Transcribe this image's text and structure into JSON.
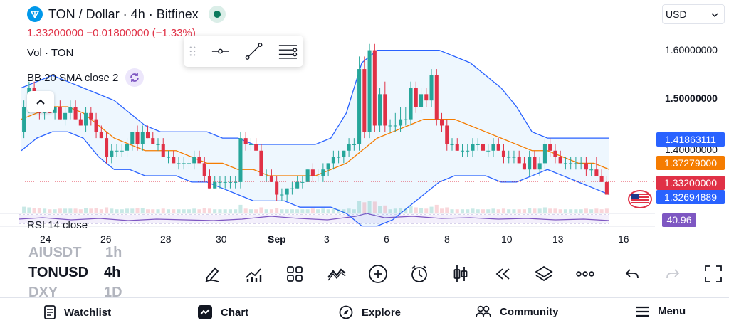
{
  "header": {
    "symbol_title": "TON / Dollar · 4h · Bitfinex",
    "price_line": "1.33200000  −0.01800000 (−1.33%)",
    "volume_label": "Vol · TON",
    "bb_label": "BB 20 SMA close 2"
  },
  "currency_selector": {
    "value": "USD"
  },
  "price_axis": {
    "ticks": [
      "1.60000000",
      "1.50000000",
      "1.40000000"
    ]
  },
  "price_labels": {
    "upper_band": "1.41863111",
    "basis": "1.37279000",
    "last_price": "1.33200000",
    "lower_band": "1.32694889"
  },
  "rsi": {
    "label": "RSI 14 close",
    "value": "40.96"
  },
  "time_axis": [
    "24",
    "26",
    "28",
    "30",
    "Sep",
    "3",
    "6",
    "8",
    "10",
    "13",
    "16"
  ],
  "watchlist": {
    "prev": "AIUSDT",
    "prev_tf": "1h",
    "current": "TONUSD",
    "current_tf": "4h",
    "next": "DXY",
    "next_tf": "1D"
  },
  "bottom_nav": [
    {
      "label": "Watchlist",
      "icon": "watchlist-icon"
    },
    {
      "label": "Chart",
      "icon": "chart-icon"
    },
    {
      "label": "Explore",
      "icon": "compass-icon"
    },
    {
      "label": "Community",
      "icon": "community-icon"
    },
    {
      "label": "Menu",
      "icon": "menu-icon"
    }
  ],
  "colors": {
    "up": "#26a69a",
    "down": "#e03146",
    "band": "#2962ff",
    "basis": "#f57c00",
    "rsi": "#7e57c2",
    "ton": "#0098ea"
  },
  "chart_data": {
    "type": "candlestick",
    "price_range": [
      1.3,
      1.64
    ],
    "x_labels": [
      "24",
      "26",
      "28",
      "30",
      "Sep",
      "3",
      "6",
      "8",
      "10",
      "13",
      "16"
    ],
    "candles": [
      [
        1.43,
        1.48,
        1.42,
        1.47
      ],
      [
        1.47,
        1.51,
        1.46,
        1.5
      ],
      [
        1.5,
        1.51,
        1.47,
        1.48
      ],
      [
        1.48,
        1.49,
        1.45,
        1.46
      ],
      [
        1.46,
        1.48,
        1.45,
        1.47
      ],
      [
        1.47,
        1.48,
        1.46,
        1.46
      ],
      [
        1.46,
        1.47,
        1.45,
        1.47
      ],
      [
        1.47,
        1.48,
        1.45,
        1.45
      ],
      [
        1.45,
        1.47,
        1.44,
        1.46
      ],
      [
        1.46,
        1.48,
        1.45,
        1.47
      ],
      [
        1.47,
        1.48,
        1.45,
        1.45
      ],
      [
        1.45,
        1.46,
        1.44,
        1.44
      ],
      [
        1.44,
        1.47,
        1.43,
        1.46
      ],
      [
        1.46,
        1.47,
        1.44,
        1.45
      ],
      [
        1.45,
        1.46,
        1.42,
        1.43
      ],
      [
        1.43,
        1.44,
        1.42,
        1.42
      ],
      [
        1.42,
        1.43,
        1.38,
        1.39
      ],
      [
        1.39,
        1.41,
        1.38,
        1.4
      ],
      [
        1.4,
        1.41,
        1.39,
        1.4
      ],
      [
        1.4,
        1.41,
        1.39,
        1.4
      ],
      [
        1.4,
        1.42,
        1.39,
        1.41
      ],
      [
        1.41,
        1.43,
        1.4,
        1.43
      ],
      [
        1.43,
        1.44,
        1.4,
        1.41
      ],
      [
        1.41,
        1.44,
        1.4,
        1.43
      ],
      [
        1.43,
        1.44,
        1.42,
        1.42
      ],
      [
        1.42,
        1.43,
        1.41,
        1.41
      ],
      [
        1.41,
        1.42,
        1.4,
        1.41
      ],
      [
        1.41,
        1.42,
        1.39,
        1.39
      ],
      [
        1.39,
        1.4,
        1.38,
        1.39
      ],
      [
        1.39,
        1.4,
        1.38,
        1.38
      ],
      [
        1.38,
        1.39,
        1.37,
        1.38
      ],
      [
        1.38,
        1.39,
        1.37,
        1.38
      ],
      [
        1.38,
        1.39,
        1.37,
        1.38
      ],
      [
        1.38,
        1.4,
        1.37,
        1.39
      ],
      [
        1.39,
        1.4,
        1.38,
        1.38
      ],
      [
        1.38,
        1.39,
        1.35,
        1.36
      ],
      [
        1.36,
        1.37,
        1.34,
        1.34
      ],
      [
        1.34,
        1.36,
        1.34,
        1.35
      ],
      [
        1.35,
        1.36,
        1.34,
        1.35
      ],
      [
        1.35,
        1.36,
        1.34,
        1.35
      ],
      [
        1.35,
        1.36,
        1.34,
        1.35
      ],
      [
        1.35,
        1.36,
        1.34,
        1.35
      ],
      [
        1.35,
        1.43,
        1.34,
        1.42
      ],
      [
        1.42,
        1.43,
        1.4,
        1.41
      ],
      [
        1.41,
        1.42,
        1.4,
        1.41
      ],
      [
        1.41,
        1.42,
        1.4,
        1.4
      ],
      [
        1.4,
        1.41,
        1.36,
        1.36
      ],
      [
        1.36,
        1.37,
        1.35,
        1.36
      ],
      [
        1.36,
        1.37,
        1.35,
        1.35
      ],
      [
        1.35,
        1.36,
        1.32,
        1.33
      ],
      [
        1.33,
        1.34,
        1.32,
        1.33
      ],
      [
        1.33,
        1.34,
        1.32,
        1.34
      ],
      [
        1.34,
        1.35,
        1.33,
        1.34
      ],
      [
        1.34,
        1.36,
        1.34,
        1.35
      ],
      [
        1.35,
        1.36,
        1.34,
        1.35
      ],
      [
        1.35,
        1.37,
        1.35,
        1.37
      ],
      [
        1.37,
        1.38,
        1.35,
        1.36
      ],
      [
        1.36,
        1.37,
        1.35,
        1.36
      ],
      [
        1.36,
        1.38,
        1.35,
        1.37
      ],
      [
        1.37,
        1.38,
        1.36,
        1.38
      ],
      [
        1.38,
        1.4,
        1.37,
        1.39
      ],
      [
        1.39,
        1.4,
        1.38,
        1.39
      ],
      [
        1.39,
        1.4,
        1.38,
        1.4
      ],
      [
        1.4,
        1.42,
        1.39,
        1.41
      ],
      [
        1.41,
        1.42,
        1.4,
        1.41
      ],
      [
        1.41,
        1.55,
        1.4,
        1.53
      ],
      [
        1.53,
        1.55,
        1.42,
        1.43
      ],
      [
        1.43,
        1.57,
        1.42,
        1.56
      ],
      [
        1.56,
        1.57,
        1.43,
        1.44
      ],
      [
        1.44,
        1.5,
        1.43,
        1.49
      ],
      [
        1.49,
        1.51,
        1.43,
        1.44
      ],
      [
        1.44,
        1.45,
        1.43,
        1.44
      ],
      [
        1.44,
        1.46,
        1.43,
        1.44
      ],
      [
        1.44,
        1.47,
        1.43,
        1.45
      ],
      [
        1.45,
        1.47,
        1.44,
        1.45
      ],
      [
        1.45,
        1.51,
        1.44,
        1.5
      ],
      [
        1.5,
        1.51,
        1.46,
        1.47
      ],
      [
        1.47,
        1.5,
        1.46,
        1.49
      ],
      [
        1.49,
        1.5,
        1.47,
        1.48
      ],
      [
        1.48,
        1.53,
        1.47,
        1.52
      ],
      [
        1.52,
        1.53,
        1.44,
        1.45
      ],
      [
        1.45,
        1.46,
        1.43,
        1.44
      ],
      [
        1.44,
        1.45,
        1.4,
        1.41
      ],
      [
        1.41,
        1.42,
        1.4,
        1.41
      ],
      [
        1.41,
        1.42,
        1.4,
        1.4
      ],
      [
        1.4,
        1.41,
        1.39,
        1.4
      ],
      [
        1.4,
        1.41,
        1.39,
        1.4
      ],
      [
        1.4,
        1.42,
        1.39,
        1.41
      ],
      [
        1.41,
        1.42,
        1.4,
        1.41
      ],
      [
        1.41,
        1.42,
        1.4,
        1.4
      ],
      [
        1.4,
        1.41,
        1.39,
        1.4
      ],
      [
        1.4,
        1.42,
        1.39,
        1.41
      ],
      [
        1.41,
        1.42,
        1.4,
        1.4
      ],
      [
        1.4,
        1.41,
        1.38,
        1.39
      ],
      [
        1.39,
        1.4,
        1.38,
        1.39
      ],
      [
        1.39,
        1.4,
        1.38,
        1.39
      ],
      [
        1.39,
        1.4,
        1.38,
        1.38
      ],
      [
        1.38,
        1.39,
        1.37,
        1.37
      ],
      [
        1.37,
        1.4,
        1.36,
        1.39
      ],
      [
        1.39,
        1.4,
        1.37,
        1.37
      ],
      [
        1.37,
        1.39,
        1.36,
        1.38
      ],
      [
        1.38,
        1.42,
        1.37,
        1.41
      ],
      [
        1.41,
        1.42,
        1.39,
        1.4
      ],
      [
        1.4,
        1.41,
        1.38,
        1.39
      ],
      [
        1.39,
        1.4,
        1.38,
        1.38
      ],
      [
        1.38,
        1.39,
        1.37,
        1.38
      ],
      [
        1.38,
        1.39,
        1.37,
        1.38
      ],
      [
        1.38,
        1.39,
        1.37,
        1.38
      ],
      [
        1.38,
        1.39,
        1.37,
        1.38
      ],
      [
        1.38,
        1.39,
        1.36,
        1.37
      ],
      [
        1.37,
        1.38,
        1.36,
        1.37
      ],
      [
        1.37,
        1.39,
        1.36,
        1.36
      ],
      [
        1.36,
        1.37,
        1.35,
        1.35
      ],
      [
        1.35,
        1.36,
        1.33,
        1.33
      ]
    ],
    "upper_band": [
      1.5,
      1.51,
      1.52,
      1.51,
      1.5,
      1.49,
      1.48,
      1.46,
      1.44,
      1.43,
      1.43,
      1.43,
      1.43,
      1.42,
      1.42,
      1.41,
      1.41,
      1.41,
      1.41,
      1.41,
      1.42,
      1.46,
      1.54,
      1.56,
      1.56,
      1.56,
      1.56,
      1.56,
      1.55,
      1.54,
      1.52,
      1.5,
      1.47,
      1.43,
      1.42,
      1.42,
      1.42,
      1.42,
      1.42
    ],
    "basis": [
      1.45,
      1.46,
      1.47,
      1.47,
      1.46,
      1.44,
      1.42,
      1.41,
      1.4,
      1.4,
      1.4,
      1.39,
      1.38,
      1.38,
      1.37,
      1.37,
      1.36,
      1.36,
      1.36,
      1.36,
      1.37,
      1.38,
      1.4,
      1.42,
      1.43,
      1.44,
      1.45,
      1.45,
      1.45,
      1.44,
      1.43,
      1.42,
      1.41,
      1.4,
      1.4,
      1.39,
      1.38,
      1.38,
      1.37
    ],
    "lower_band": [
      1.4,
      1.42,
      1.43,
      1.43,
      1.42,
      1.39,
      1.37,
      1.37,
      1.36,
      1.36,
      1.36,
      1.35,
      1.35,
      1.34,
      1.33,
      1.32,
      1.32,
      1.32,
      1.31,
      1.31,
      1.31,
      1.3,
      1.28,
      1.28,
      1.29,
      1.31,
      1.33,
      1.35,
      1.36,
      1.36,
      1.36,
      1.35,
      1.35,
      1.36,
      1.37,
      1.36,
      1.35,
      1.34,
      1.33
    ]
  }
}
